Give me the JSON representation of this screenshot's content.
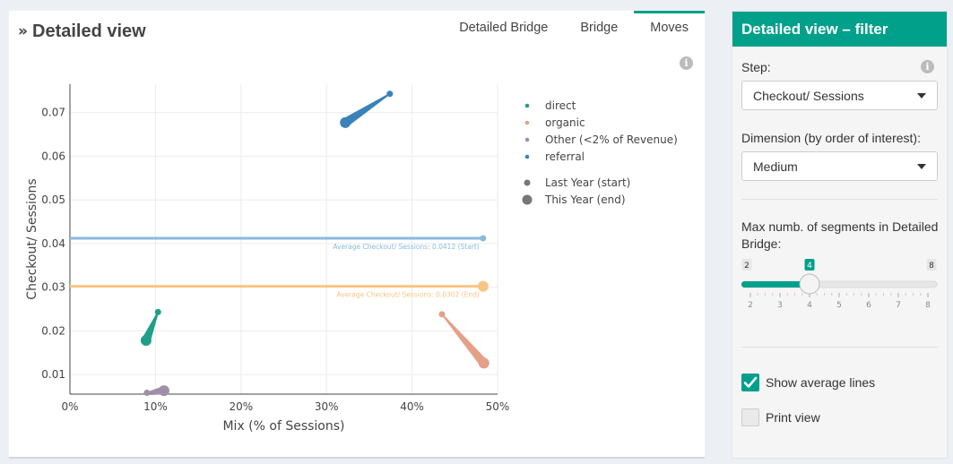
{
  "main": {
    "title": "Detailed view",
    "tabs": [
      {
        "label": "Detailed Bridge",
        "active": false
      },
      {
        "label": "Bridge",
        "active": false
      },
      {
        "label": "Moves",
        "active": true
      }
    ]
  },
  "filter": {
    "title": "Detailed view – filter",
    "step_label": "Step:",
    "step_value": "Checkout/ Sessions",
    "dimension_label": "Dimension (by order of interest):",
    "dimension_value": "Medium",
    "segments_label": "Max numb. of segments in Detailed Bridge:",
    "slider": {
      "min": 2,
      "max": 8,
      "value": 4,
      "ticks": [
        2,
        3,
        4,
        5,
        6,
        7,
        8
      ],
      "min_label": "2",
      "max_label": "8",
      "value_label": "4"
    },
    "show_average_lines": {
      "label": "Show average lines",
      "checked": true
    },
    "print_view": {
      "label": "Print view",
      "checked": false
    }
  },
  "colors": {
    "accent": "#00a08a",
    "direct": "#1f9e89",
    "organic": "#e5a088",
    "other": "#a08fa8",
    "referral": "#3a82b8",
    "avg_start": "#8ab9de",
    "avg_end": "#f8c585"
  },
  "chart_data": {
    "type": "scatter",
    "xlabel": "Mix (% of Sessions)",
    "ylabel": "Checkout/ Sessions",
    "xlim": [
      0,
      0.5
    ],
    "ylim": [
      0.0055,
      0.0765
    ],
    "x_ticks": [
      {
        "v": 0,
        "label": "0%"
      },
      {
        "v": 0.1,
        "label": "10%"
      },
      {
        "v": 0.2,
        "label": "20%"
      },
      {
        "v": 0.3,
        "label": "30%"
      },
      {
        "v": 0.4,
        "label": "40%"
      },
      {
        "v": 0.5,
        "label": "50%"
      }
    ],
    "y_ticks": [
      {
        "v": 0.01,
        "label": "0.01"
      },
      {
        "v": 0.02,
        "label": "0.02"
      },
      {
        "v": 0.03,
        "label": "0.03"
      },
      {
        "v": 0.04,
        "label": "0.04"
      },
      {
        "v": 0.05,
        "label": "0.05"
      },
      {
        "v": 0.06,
        "label": "0.06"
      },
      {
        "v": 0.07,
        "label": "0.07"
      }
    ],
    "grid": true,
    "legend_position": "right",
    "series": [
      {
        "name": "direct",
        "color": "#1f9e89",
        "start": [
          0.103,
          0.0243
        ],
        "end": [
          0.089,
          0.0178
        ]
      },
      {
        "name": "organic",
        "color": "#e5a088",
        "start": [
          0.435,
          0.0238
        ],
        "end": [
          0.484,
          0.0126
        ]
      },
      {
        "name": "Other (<2% of Revenue)",
        "color": "#a08fa8",
        "start": [
          0.09,
          0.0058
        ],
        "end": [
          0.11,
          0.0063
        ]
      },
      {
        "name": "referral",
        "color": "#3a82b8",
        "start": [
          0.374,
          0.0743
        ],
        "end": [
          0.322,
          0.0677
        ]
      }
    ],
    "size_legend": [
      "Last Year (start)",
      "This Year (end)"
    ],
    "avg_lines": [
      {
        "y": 0.0412,
        "x_end": 0.483,
        "label": "Average Checkout/ Sessions: 0.0412 (Start)",
        "color": "#8ab9de",
        "marker_size": "start"
      },
      {
        "y": 0.0302,
        "x_end": 0.483,
        "label": "Average Checkout/ Sessions: 0.0302 (End)",
        "color": "#f8c585",
        "marker_size": "end"
      }
    ]
  }
}
